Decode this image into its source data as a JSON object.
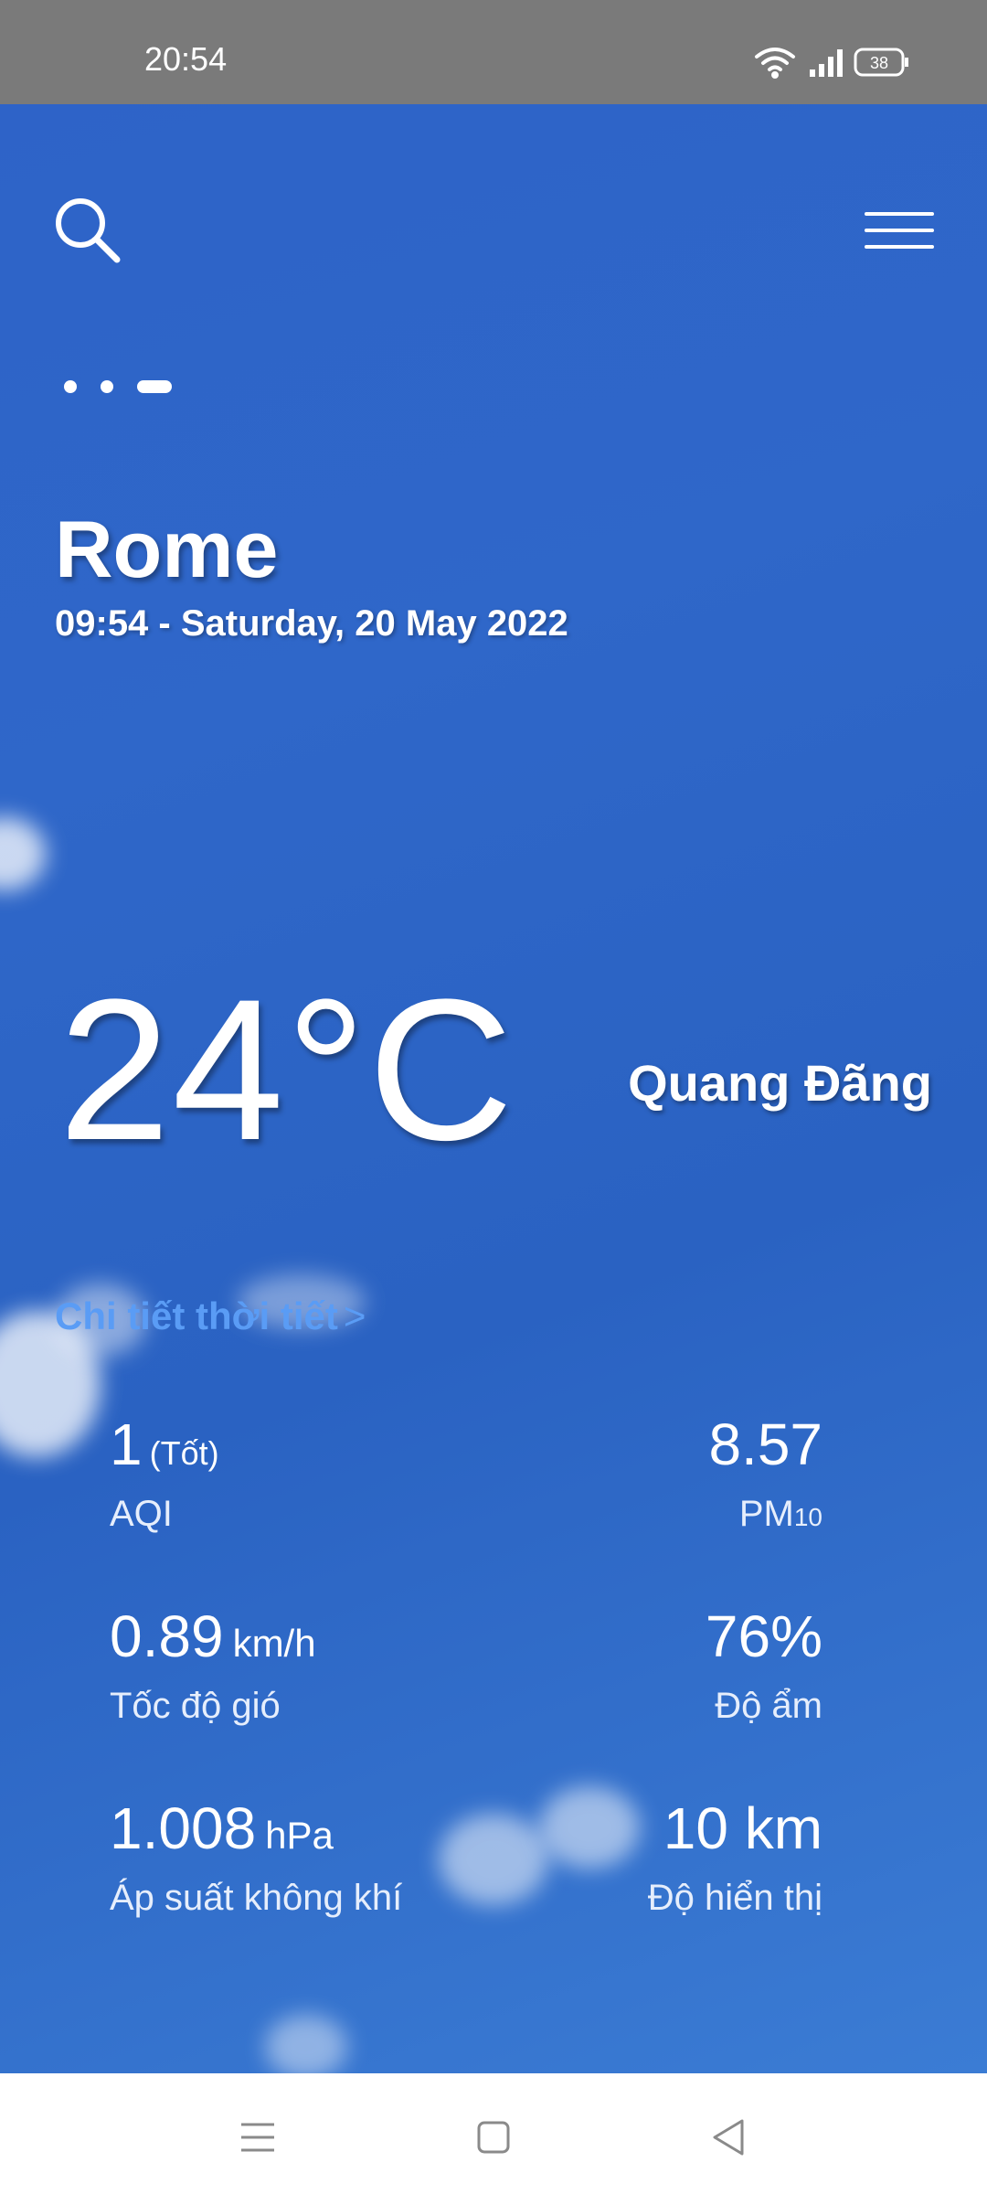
{
  "status": {
    "time": "20:54",
    "battery": "38"
  },
  "header": {
    "search_icon": "search-icon",
    "menu_icon": "menu-icon"
  },
  "location": {
    "city": "Rome",
    "datetime": "09:54 - Saturday, 20 May 2022"
  },
  "current": {
    "temperature": "24°C",
    "condition": "Quang Đãng"
  },
  "details_link": {
    "label": "Chi tiết thời tiết",
    "chevron": ">"
  },
  "metrics": {
    "aqi": {
      "value": "1",
      "note": "(Tốt)",
      "label": "AQI"
    },
    "pm10": {
      "value": "8.57",
      "label": "PM",
      "sub": "10"
    },
    "wind": {
      "value": "0.89",
      "unit": "km/h",
      "label": "Tốc độ gió"
    },
    "humidity": {
      "value": "76%",
      "label": "Độ ẩm"
    },
    "pressure": {
      "value": "1.008",
      "unit": "hPa",
      "label": "Áp suất không khí"
    },
    "visibility": {
      "value": "10 km",
      "label": "Độ hiển thị"
    }
  },
  "colors": {
    "accent_link": "#5a9cf5",
    "sky": "#2a62c0",
    "statusbar": "#7a7a7a"
  }
}
